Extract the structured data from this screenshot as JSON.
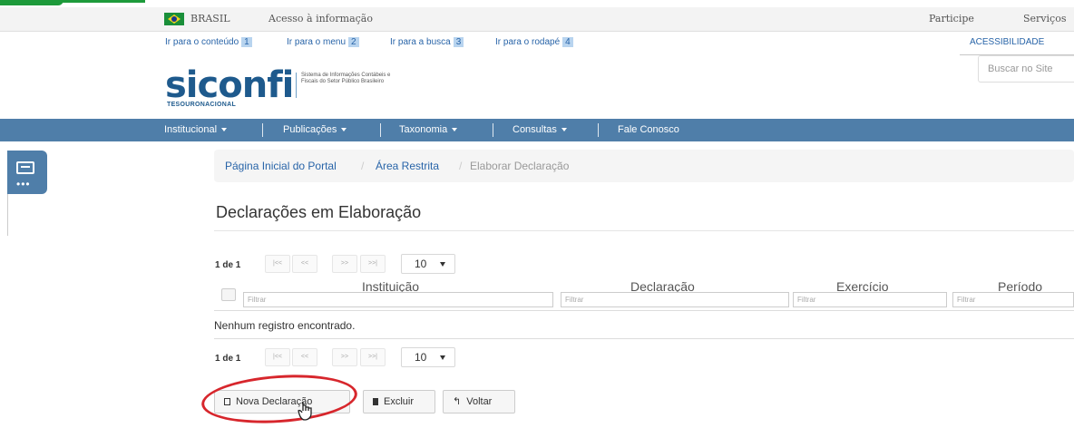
{
  "govbar": {
    "country": "BRASIL",
    "info": "Acesso à informação",
    "participe": "Participe",
    "servicos": "Serviços"
  },
  "skip_links": [
    {
      "label": "Ir para o conteúdo",
      "key": "1"
    },
    {
      "label": "Ir para o menu",
      "key": "2"
    },
    {
      "label": "Ir para a busca",
      "key": "3"
    },
    {
      "label": "Ir para o rodapé",
      "key": "4"
    }
  ],
  "accessibility": "ACESSIBILIDADE",
  "search": {
    "placeholder": "Buscar no Site"
  },
  "logo": {
    "name": "siconfi",
    "subtitle": "Sistema de Informações Contábeis e Fiscais do Setor Público Brasileiro",
    "brand": "TESOURONACIONAL"
  },
  "nav": {
    "items": [
      "Institucional",
      "Publicações",
      "Taxonomia",
      "Consultas",
      "Fale Conosco"
    ]
  },
  "breadcrumb": {
    "items": [
      "Página Inicial do Portal",
      "Área Restrita",
      "Elaborar Declaração"
    ],
    "sep": "/"
  },
  "page": {
    "title": "Declarações em Elaboração"
  },
  "paginator": {
    "text": "1 de 1",
    "rows": "10",
    "buttons": [
      "|<<",
      "<<",
      ">>",
      ">>|"
    ]
  },
  "table": {
    "columns": [
      "Instituição",
      "Declaração",
      "Exercício",
      "Período"
    ],
    "filter_placeholder": "Filtrar",
    "empty": "Nenhum registro encontrado."
  },
  "actions": {
    "new": "Nova Declaração",
    "delete": "Excluir",
    "back": "Voltar"
  },
  "colors": {
    "nav": "#4f7ea9",
    "link": "#2864a8",
    "highlight": "#d7262c"
  }
}
